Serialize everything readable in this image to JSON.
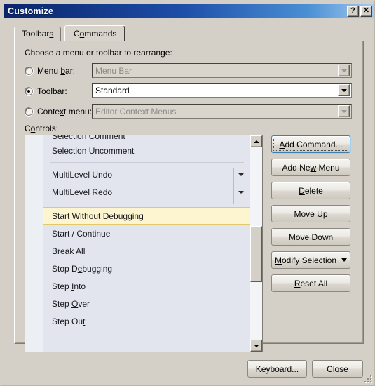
{
  "window": {
    "title": "Customize",
    "help_button": "?",
    "close_button": "✕"
  },
  "tabs": [
    {
      "label_before": "Toolbar",
      "accel": "s",
      "label_after": "",
      "active": false,
      "name": "tab-toolbars"
    },
    {
      "label_before": "C",
      "accel": "o",
      "label_after": "mmands",
      "active": true,
      "name": "tab-commands"
    }
  ],
  "panel": {
    "instruction": "Choose a menu or toolbar to rearrange:",
    "controls_label_before": "C",
    "controls_accel": "o",
    "controls_label_after": "ntrols:",
    "options": [
      {
        "name": "menu-bar",
        "label_before": "Menu ",
        "accel": "b",
        "label_after": "ar:",
        "checked": false,
        "disabled": true,
        "value": "Menu Bar"
      },
      {
        "name": "toolbar",
        "label_before": "",
        "accel": "T",
        "label_after": "oolbar:",
        "checked": true,
        "disabled": false,
        "value": "Standard"
      },
      {
        "name": "context-menu",
        "label_before": "Conte",
        "accel": "x",
        "label_after": "t menu:",
        "checked": false,
        "disabled": true,
        "value": "Editor Context Menus"
      }
    ]
  },
  "controls_list": [
    {
      "type": "item",
      "icon": "comment-lines-icon",
      "label_before": "Selection Comment",
      "accel": "",
      "label_after": "",
      "selected": false,
      "dropdown": false,
      "clipped": true
    },
    {
      "type": "item",
      "icon": "uncomment-lines-icon",
      "label_before": "Selection Uncomment",
      "accel": "",
      "label_after": "",
      "selected": false,
      "dropdown": false
    },
    {
      "type": "separator"
    },
    {
      "type": "item",
      "icon": "undo-arrow-icon",
      "label_before": "MultiLevel Undo",
      "accel": "",
      "label_after": "",
      "selected": false,
      "dropdown": true
    },
    {
      "type": "item",
      "icon": "redo-arrow-icon",
      "label_before": "MultiLevel Redo",
      "accel": "",
      "label_after": "",
      "selected": false,
      "dropdown": true
    },
    {
      "type": "separator"
    },
    {
      "type": "item",
      "icon": "start-without-debugging-icon",
      "label_before": "Start With",
      "accel": "o",
      "label_after": "ut Debugging",
      "selected": true,
      "dropdown": false
    },
    {
      "type": "item",
      "icon": "start-continue-icon",
      "label_before": "Start / Continue",
      "accel": "",
      "label_after": "",
      "selected": false,
      "dropdown": false
    },
    {
      "type": "item",
      "icon": "break-all-icon",
      "label_before": "Brea",
      "accel": "k",
      "label_after": " All",
      "selected": false,
      "dropdown": false
    },
    {
      "type": "item",
      "icon": "stop-debugging-icon",
      "label_before": "Stop D",
      "accel": "e",
      "label_after": "bugging",
      "selected": false,
      "dropdown": false
    },
    {
      "type": "item",
      "icon": "step-into-icon",
      "label_before": "Step ",
      "accel": "I",
      "label_after": "nto",
      "selected": false,
      "dropdown": false
    },
    {
      "type": "item",
      "icon": "step-over-icon",
      "label_before": "Step ",
      "accel": "O",
      "label_after": "ver",
      "selected": false,
      "dropdown": false
    },
    {
      "type": "item",
      "icon": "step-out-icon",
      "label_before": "Step Ou",
      "accel": "t",
      "label_after": "",
      "selected": false,
      "dropdown": false
    },
    {
      "type": "separator"
    }
  ],
  "side_buttons": [
    {
      "name": "add-command-button",
      "label_before": "",
      "accel": "A",
      "label_after": "dd Command...",
      "focused": true,
      "caret": false
    },
    {
      "name": "add-new-menu-button",
      "label_before": "Add Ne",
      "accel": "w",
      "label_after": " Menu",
      "focused": false,
      "caret": false
    },
    {
      "name": "delete-button",
      "label_before": "",
      "accel": "D",
      "label_after": "elete",
      "focused": false,
      "caret": false
    },
    {
      "name": "move-up-button",
      "label_before": "Move U",
      "accel": "p",
      "label_after": "",
      "focused": false,
      "caret": false
    },
    {
      "name": "move-down-button",
      "label_before": "Move Dow",
      "accel": "n",
      "label_after": "",
      "focused": false,
      "caret": false
    },
    {
      "name": "modify-selection-button",
      "label_before": "",
      "accel": "M",
      "label_after": "odify Selection",
      "focused": false,
      "caret": true
    },
    {
      "name": "reset-all-button",
      "label_before": "",
      "accel": "R",
      "label_after": "eset All",
      "focused": false,
      "caret": false
    }
  ],
  "footer_buttons": [
    {
      "name": "keyboard-button",
      "label_before": "",
      "accel": "K",
      "label_after": "eyboard...",
      "focused": false
    },
    {
      "name": "close-button",
      "label_before": "Close",
      "accel": "",
      "label_after": "",
      "focused": false
    }
  ],
  "colors": {
    "dialog_face": "#d4d0c8",
    "title_gradient_start": "#0a246a",
    "title_gradient_end": "#a6caf0",
    "list_background": "#e2e5ee",
    "selection_fill": "#fdf4d0",
    "selection_border": "#e3c86a",
    "focus_border": "#3c7fb1",
    "debug_green": "#2f8b2f",
    "debug_blue": "#3a6bbf"
  },
  "scrollbar": {
    "up_arrow": "▲",
    "down_arrow": "▼",
    "thumb_top_pct": 41,
    "thumb_height_pct": 29
  }
}
